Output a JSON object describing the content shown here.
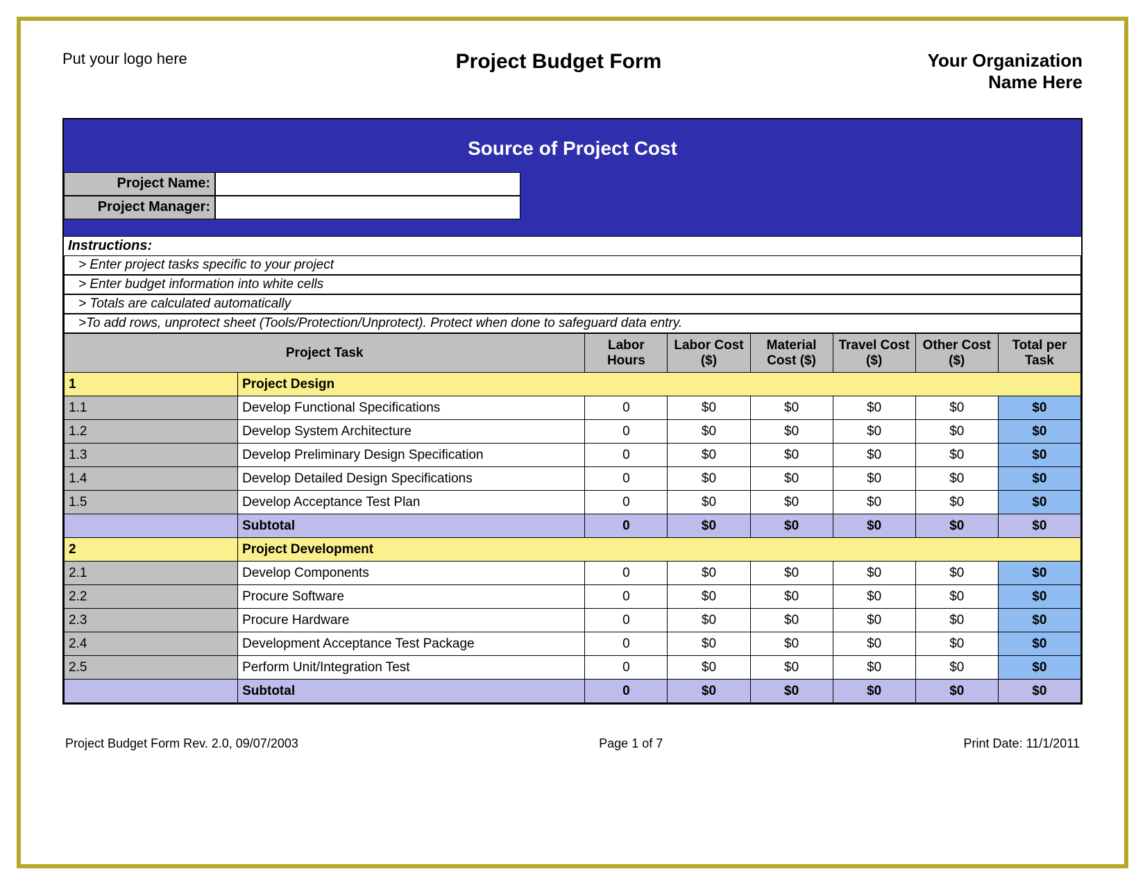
{
  "header": {
    "logo_placeholder": "Put your logo here",
    "title": "Project Budget Form",
    "org_line1": "Your Organization",
    "org_line2": "Name Here"
  },
  "banner": "Source of Project Cost",
  "meta": {
    "project_name_label": "Project Name:",
    "project_name_value": "",
    "project_manager_label": "Project Manager:",
    "project_manager_value": ""
  },
  "instructions": {
    "heading": "Instructions:",
    "lines": [
      "> Enter project tasks specific to your project",
      "> Enter budget information into white cells",
      "> Totals are calculated automatically",
      ">To add rows, unprotect sheet (Tools/Protection/Unprotect).  Protect when done to safeguard data entry."
    ]
  },
  "columns": {
    "task": "Project Task",
    "labor_hours": "Labor Hours",
    "labor_cost": "Labor Cost ($)",
    "material_cost": "Material Cost ($)",
    "travel_cost": "Travel Cost ($)",
    "other_cost": "Other Cost ($)",
    "total": "Total per Task"
  },
  "sections": [
    {
      "num": "1",
      "title": "Project Design",
      "rows": [
        {
          "id": "1.1",
          "task": "Develop Functional Specifications",
          "hours": "0",
          "labor": "$0",
          "material": "$0",
          "travel": "$0",
          "other": "$0",
          "total": "$0"
        },
        {
          "id": "1.2",
          "task": "Develop System Architecture",
          "hours": "0",
          "labor": "$0",
          "material": "$0",
          "travel": "$0",
          "other": "$0",
          "total": "$0"
        },
        {
          "id": "1.3",
          "task": "Develop Preliminary Design Specification",
          "hours": "0",
          "labor": "$0",
          "material": "$0",
          "travel": "$0",
          "other": "$0",
          "total": "$0"
        },
        {
          "id": "1.4",
          "task": "Develop Detailed Design Specifications",
          "hours": "0",
          "labor": "$0",
          "material": "$0",
          "travel": "$0",
          "other": "$0",
          "total": "$0"
        },
        {
          "id": "1.5",
          "task": "Develop Acceptance Test Plan",
          "hours": "0",
          "labor": "$0",
          "material": "$0",
          "travel": "$0",
          "other": "$0",
          "total": "$0"
        }
      ],
      "subtotal": {
        "label": "Subtotal",
        "hours": "0",
        "labor": "$0",
        "material": "$0",
        "travel": "$0",
        "other": "$0",
        "total": "$0"
      }
    },
    {
      "num": "2",
      "title": "Project Development",
      "rows": [
        {
          "id": "2.1",
          "task": "Develop Components",
          "hours": "0",
          "labor": "$0",
          "material": "$0",
          "travel": "$0",
          "other": "$0",
          "total": "$0"
        },
        {
          "id": "2.2",
          "task": "Procure Software",
          "hours": "0",
          "labor": "$0",
          "material": "$0",
          "travel": "$0",
          "other": "$0",
          "total": "$0"
        },
        {
          "id": "2.3",
          "task": "Procure Hardware",
          "hours": "0",
          "labor": "$0",
          "material": "$0",
          "travel": "$0",
          "other": "$0",
          "total": "$0"
        },
        {
          "id": "2.4",
          "task": "Development Acceptance Test Package",
          "hours": "0",
          "labor": "$0",
          "material": "$0",
          "travel": "$0",
          "other": "$0",
          "total": "$0"
        },
        {
          "id": "2.5",
          "task": "Perform Unit/Integration Test",
          "hours": "0",
          "labor": "$0",
          "material": "$0",
          "travel": "$0",
          "other": "$0",
          "total": "$0"
        }
      ],
      "subtotal": {
        "label": "Subtotal",
        "hours": "0",
        "labor": "$0",
        "material": "$0",
        "travel": "$0",
        "other": "$0",
        "total": "$0"
      }
    }
  ],
  "footer": {
    "revision": "Project Budget Form Rev. 2.0, 09/07/2003",
    "page": "Page 1 of 7",
    "print_date": "Print Date: 11/1/2011"
  }
}
